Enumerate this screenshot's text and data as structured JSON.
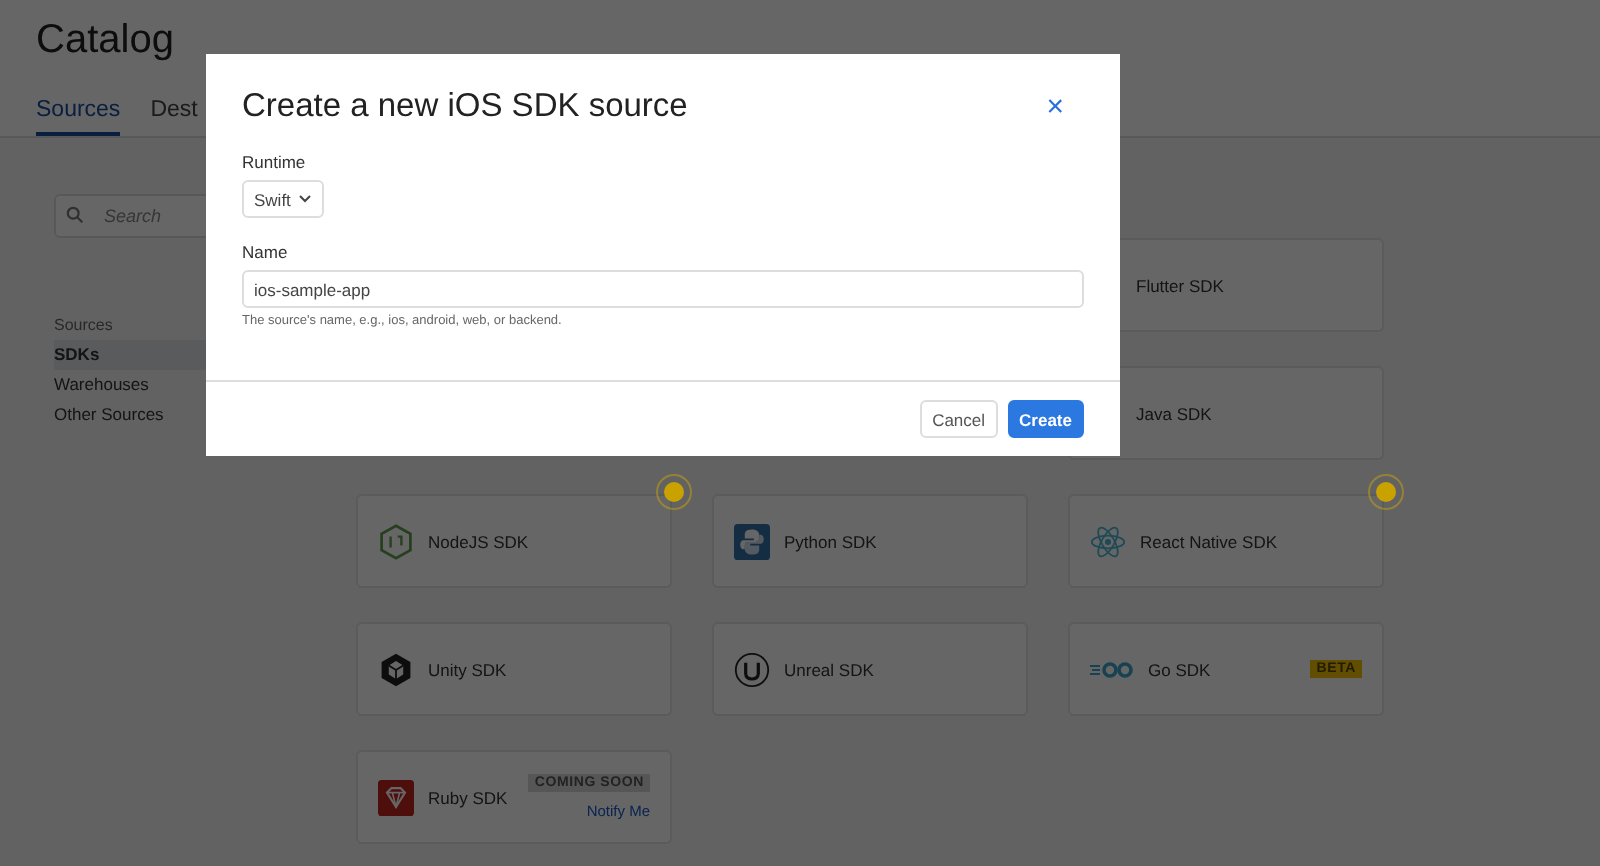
{
  "page": {
    "title": "Catalog"
  },
  "tabs": [
    {
      "label": "Sources",
      "selected": true
    },
    {
      "label": "Dest",
      "selected": false
    }
  ],
  "sidebar": {
    "search": {
      "placeholder": "Search"
    },
    "section": "Sources",
    "items": [
      {
        "label": "SDKs",
        "selected": true
      },
      {
        "label": "Warehouses",
        "selected": false
      },
      {
        "label": "Other Sources",
        "selected": false
      }
    ]
  },
  "cards": [
    {
      "name": "Flutter SDK",
      "beacon": false
    },
    {
      "name": "Java SDK",
      "beacon": false
    },
    {
      "name": "NodeJS SDK",
      "kind": "node",
      "beacon": true
    },
    {
      "name": "Python SDK",
      "kind": "python",
      "beacon": false
    },
    {
      "name": "React Native SDK",
      "kind": "react",
      "beacon": true
    },
    {
      "name": "Unity SDK",
      "kind": "unity",
      "beacon": false
    },
    {
      "name": "Unreal SDK",
      "kind": "unreal",
      "beacon": false
    },
    {
      "name": "Go SDK",
      "kind": "go",
      "badge": {
        "kind": "beta",
        "label": "BETA"
      },
      "beacon": false
    },
    {
      "name": "Ruby SDK",
      "kind": "ruby",
      "badge": {
        "kind": "soon",
        "label": "COMING SOON"
      },
      "link": "Notify Me",
      "beacon": false
    }
  ],
  "dialog": {
    "title": "Create a new iOS SDK source",
    "close": "×",
    "runtime": {
      "label": "Runtime",
      "value": "Swift"
    },
    "name": {
      "label": "Name",
      "value": "ios-sample-app",
      "hint": "The source's name, e.g., ios, android, web, or backend."
    },
    "buttons": [
      {
        "label": "Cancel",
        "kind": "secondary"
      },
      {
        "label": "Create",
        "kind": "primary"
      }
    ]
  }
}
